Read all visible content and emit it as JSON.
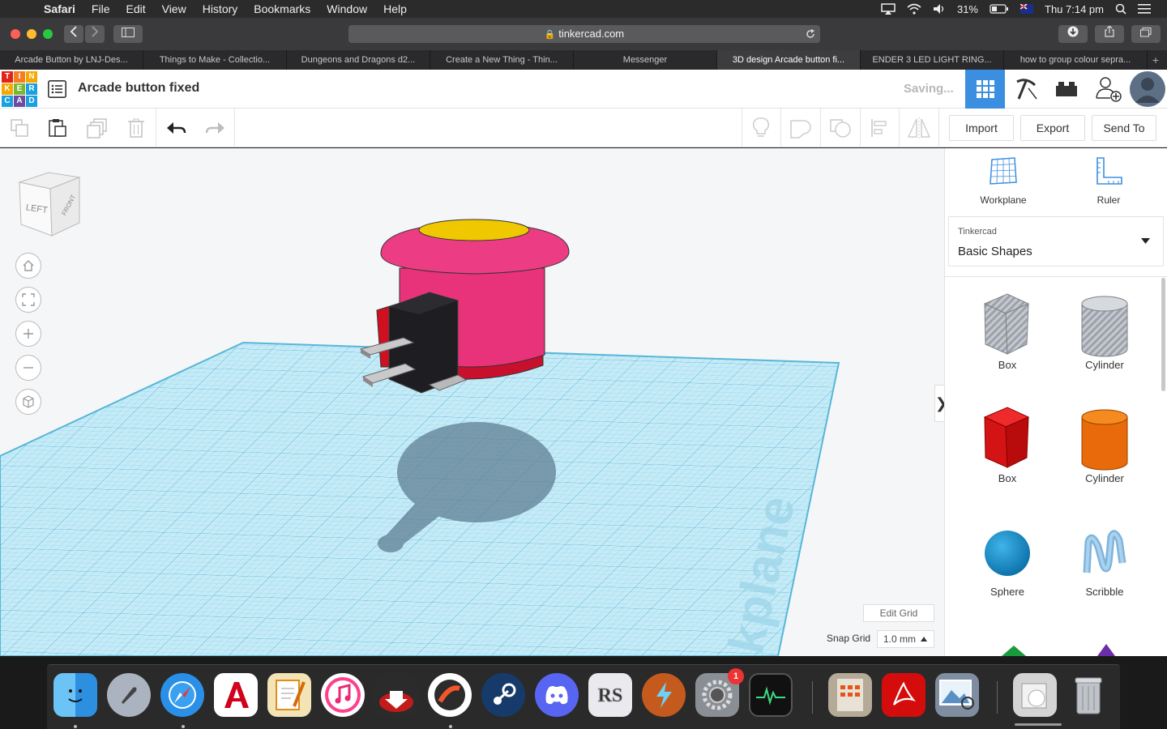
{
  "menubar": {
    "apple": "",
    "items": [
      "Safari",
      "File",
      "Edit",
      "View",
      "History",
      "Bookmarks",
      "Window",
      "Help"
    ],
    "battery": "31%",
    "clock": "Thu 7:14 pm"
  },
  "browser": {
    "url": "tinkercad.com",
    "tabs": [
      "Arcade Button by LNJ-Des...",
      "Things to Make - Collectio...",
      "Dungeons and Dragons d2...",
      "Create a New Thing - Thin...",
      "Messenger",
      "3D design Arcade button fi...",
      "ENDER 3 LED LIGHT RING...",
      "how to group colour sepra..."
    ],
    "active_tab": 5,
    "new_tab": "+"
  },
  "app": {
    "logo_letters": [
      "T",
      "I",
      "N",
      "K",
      "E",
      "R",
      "C",
      "A",
      "D"
    ],
    "logo_colors": [
      "#e2231a",
      "#f57e20",
      "#f5a800",
      "#f5a800",
      "#7ab733",
      "#1a9fe0",
      "#1a9fe0",
      "#6c4ba3",
      "#1a9fe0"
    ],
    "design_title": "Arcade button fixed",
    "status": "Saving...",
    "accent": "#3c8fe0"
  },
  "toolbar": {
    "import": "Import",
    "export": "Export",
    "send_to": "Send To"
  },
  "viewcube": {
    "left": "LEFT",
    "front": "FRONT"
  },
  "workspace": {
    "edit_grid": "Edit Grid",
    "snap_label": "Snap Grid",
    "snap_value": "1.0 mm",
    "workplane_watermark": "kplane",
    "collapse": "❯"
  },
  "panel": {
    "workplane": "Workplane",
    "ruler": "Ruler",
    "library_category": "Tinkercad",
    "library_name": "Basic Shapes",
    "shapes": [
      {
        "label": "Box",
        "icon": "box-striped-icon"
      },
      {
        "label": "Cylinder",
        "icon": "cylinder-striped-icon"
      },
      {
        "label": "Box",
        "icon": "box-red-icon"
      },
      {
        "label": "Cylinder",
        "icon": "cylinder-orange-icon"
      },
      {
        "label": "Sphere",
        "icon": "sphere-icon"
      },
      {
        "label": "Scribble",
        "icon": "scribble-icon"
      }
    ]
  },
  "dock": {
    "settings_badge": "1"
  }
}
